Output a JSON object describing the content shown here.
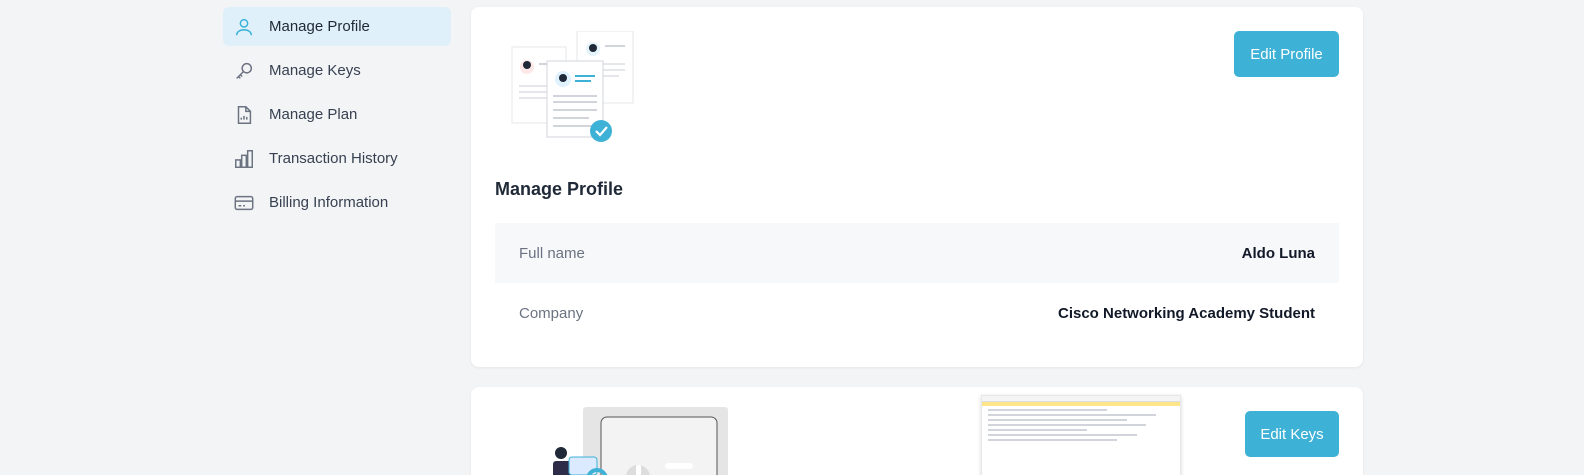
{
  "sidebar": {
    "items": [
      {
        "label": "Manage Profile",
        "icon": "user-icon",
        "active": true
      },
      {
        "label": "Manage Keys",
        "icon": "key-icon"
      },
      {
        "label": "Manage Plan",
        "icon": "document-chart-icon"
      },
      {
        "label": "Transaction History",
        "icon": "bar-chart-icon"
      },
      {
        "label": "Billing Information",
        "icon": "credit-card-icon"
      }
    ]
  },
  "profile": {
    "edit_button": "Edit Profile",
    "title": "Manage Profile",
    "rows": [
      {
        "label": "Full name",
        "value": "Aldo Luna"
      },
      {
        "label": "Company",
        "value": "Cisco Networking Academy Student"
      }
    ]
  },
  "keys": {
    "edit_button": "Edit Keys"
  },
  "colors": {
    "accent": "#3eb1d6",
    "active_bg": "#e0f0fb",
    "page_bg": "#f3f4f6"
  }
}
